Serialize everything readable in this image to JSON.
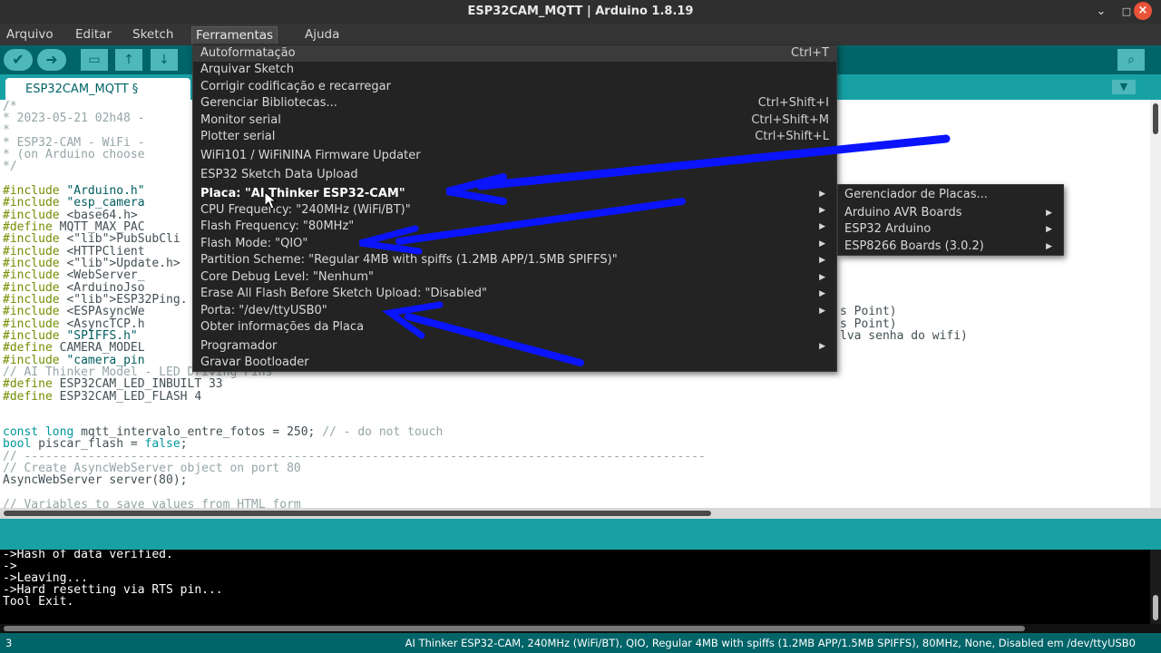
{
  "window": {
    "title": "ESP32CAM_MQTT | Arduino 1.8.19",
    "minimize": "⌄",
    "maximize": "□",
    "close": "×"
  },
  "menubar": [
    "Arquivo",
    "Editar",
    "Sketch",
    "Ferramentas",
    "Ajuda"
  ],
  "toolbar": {
    "verify_icon": "✔",
    "upload_icon": "➜",
    "new_icon": "▭",
    "open_icon": "↑",
    "save_icon": "↓",
    "serial_monitor_icon": "⌕"
  },
  "tab": {
    "name": "ESP32CAM_MQTT §",
    "menu_icon": "▼"
  },
  "tools_menu": [
    {
      "label": "Autoformatação",
      "shortcut": "Ctrl+T",
      "submenu": false,
      "bold": false
    },
    {
      "label": "Arquivar Sketch",
      "shortcut": "",
      "submenu": false,
      "bold": false
    },
    {
      "label": "Corrigir codificação e recarregar",
      "shortcut": "",
      "submenu": false,
      "bold": false
    },
    {
      "label": "Gerenciar Bibliotecas...",
      "shortcut": "Ctrl+Shift+I",
      "submenu": false,
      "bold": false
    },
    {
      "label": "Monitor serial",
      "shortcut": "Ctrl+Shift+M",
      "submenu": false,
      "bold": false
    },
    {
      "label": "Plotter serial",
      "shortcut": "Ctrl+Shift+L",
      "submenu": false,
      "bold": false
    },
    {
      "label": "WiFi101 / WiFiNINA Firmware Updater",
      "shortcut": "",
      "submenu": false,
      "bold": false
    },
    {
      "label": "ESP32 Sketch Data Upload",
      "shortcut": "",
      "submenu": false,
      "bold": false
    },
    {
      "label": "Placa: \"AI Thinker ESP32-CAM\"",
      "shortcut": "",
      "submenu": true,
      "bold": true
    },
    {
      "label": "CPU Frequency: \"240MHz (WiFi/BT)\"",
      "shortcut": "",
      "submenu": true,
      "bold": false
    },
    {
      "label": "Flash Frequency: \"80MHz\"",
      "shortcut": "",
      "submenu": true,
      "bold": false
    },
    {
      "label": "Flash Mode: \"QIO\"",
      "shortcut": "",
      "submenu": true,
      "bold": false
    },
    {
      "label": "Partition Scheme: \"Regular 4MB with spiffs (1.2MB APP/1.5MB SPIFFS)\"",
      "shortcut": "",
      "submenu": true,
      "bold": false
    },
    {
      "label": "Core Debug Level: \"Nenhum\"",
      "shortcut": "",
      "submenu": true,
      "bold": false
    },
    {
      "label": "Erase All Flash Before Sketch Upload: \"Disabled\"",
      "shortcut": "",
      "submenu": true,
      "bold": false
    },
    {
      "label": "Porta: \"/dev/ttyUSB0\"",
      "shortcut": "",
      "submenu": true,
      "bold": false
    },
    {
      "label": "Obter informações da Placa",
      "shortcut": "",
      "submenu": false,
      "bold": false
    },
    {
      "label": "Programador",
      "shortcut": "",
      "submenu": true,
      "bold": false
    },
    {
      "label": "Gravar Bootloader",
      "shortcut": "",
      "submenu": false,
      "bold": false
    }
  ],
  "board_submenu": [
    {
      "label": "Gerenciador de Placas...",
      "submenu": false
    },
    {
      "label": "Arduino AVR Boards",
      "submenu": true
    },
    {
      "label": "ESP32 Arduino",
      "submenu": true
    },
    {
      "label": "ESP8266 Boards (3.0.2)",
      "submenu": true
    }
  ],
  "submenu_arrow": "▶",
  "code_top": [
    "/*",
    "* 2023-05-21 02h48 -",
    "*",
    "* ESP32-CAM - WiFi -",
    "* (on Arduino choose",
    "*/",
    "",
    "#include \"Arduino.h\"",
    "#include \"esp_camera",
    "#include <base64.h>",
    "#define MQTT_MAX_PAC",
    "#include <PubSubCli",
    "#include <HTTPClient",
    "#include <Update.h>",
    "#include <WebServer_",
    "#include <ArduinoJso",
    "#include <ESP32Ping.",
    "#include <ESPAsyncWe",
    "#include <AsyncTCP.h",
    "#include \"SPIFFS.h\"",
    "#define CAMERA_MODEL",
    "#include \"camera_pin",
    "// AI Thinker Model - LED Driving Pins",
    "#define ESP32CAM_LED_INBUILT 33",
    "#define ESP32CAM_LED_FLASH 4"
  ],
  "code_right": [
    "s Point)",
    "s Point)",
    "lva senha do wifi)"
  ],
  "code_bottom": {
    "line1_kw": "const long",
    "line1_rest": " mqtt_intervalo_entre_fotos = 250; ",
    "line1_comment": "// - do not touch",
    "line2_kw": "bool",
    "line2_rest": " piscar_flash = ",
    "line2_val": "false",
    "line2_end": ";",
    "line3": "// ------------------------------------------------------------------------------------------------",
    "line4": "// Create AsyncWebServer object on port 80",
    "line5": "AsyncWebServer server(80);",
    "line6": "",
    "line7": "// Variables to save values from HTML form"
  },
  "console": [
    "->Hash of data verified.",
    "->",
    "->Leaving...",
    "->Hard resetting via RTS pin...",
    "Tool Exit."
  ],
  "status": {
    "line": "3",
    "board": "AI Thinker ESP32-CAM, 240MHz (WiFi/BT), QIO, Regular 4MB with spiffs (1.2MB APP/1.5MB SPIFFS), 80MHz, None, Disabled em /dev/ttyUSB0"
  },
  "colors": {
    "arrow": "#0a14ff",
    "teal": "#17a1a5",
    "dark_teal": "#006468"
  }
}
